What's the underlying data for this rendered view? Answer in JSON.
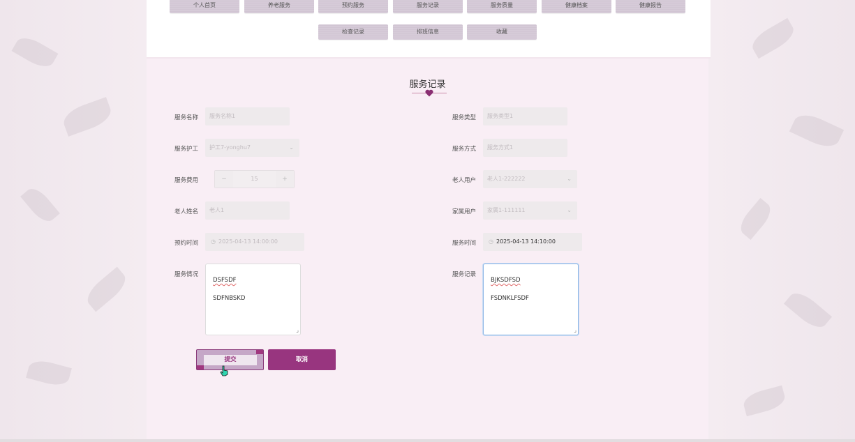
{
  "nav": {
    "row1": [
      "个人首页",
      "养老服务",
      "预约服务",
      "服务记录",
      "服务质量",
      "健康档案",
      "健康报告"
    ],
    "row2": [
      "检查记录",
      "排班信息",
      "收藏"
    ]
  },
  "page_title": "服务记录",
  "form": {
    "service_name": {
      "label": "服务名称",
      "placeholder": "服务名称1"
    },
    "service_type": {
      "label": "服务类型",
      "placeholder": "服务类型1"
    },
    "caregiver": {
      "label": "服务护工",
      "value": "护工7-yonghu7"
    },
    "service_method": {
      "label": "服务方式",
      "placeholder": "服务方式1"
    },
    "service_fee": {
      "label": "服务费用",
      "value": "15",
      "minus": "−",
      "plus": "+"
    },
    "elder_user": {
      "label": "老人用户",
      "value": "老人1-222222"
    },
    "elder_name": {
      "label": "老人姓名",
      "placeholder": "老人1"
    },
    "family_user": {
      "label": "家属用户",
      "value": "家属1-111111"
    },
    "booking_time": {
      "label": "预约时间",
      "value": "2025-04-13 14:00:00"
    },
    "service_time": {
      "label": "服务时间",
      "value": "2025-04-13 14:10:00"
    },
    "service_situation": {
      "label": "服务情况",
      "line1": "DSFSDF",
      "line2": "SDFNBSKD"
    },
    "service_record": {
      "label": "服务记录",
      "line1": "BJKSDFSD",
      "line2": "FSDNKLFSDF"
    }
  },
  "buttons": {
    "submit": "提交",
    "cancel": "取消"
  },
  "colors": {
    "accent": "#98357f",
    "heart": "#8a2e72"
  }
}
